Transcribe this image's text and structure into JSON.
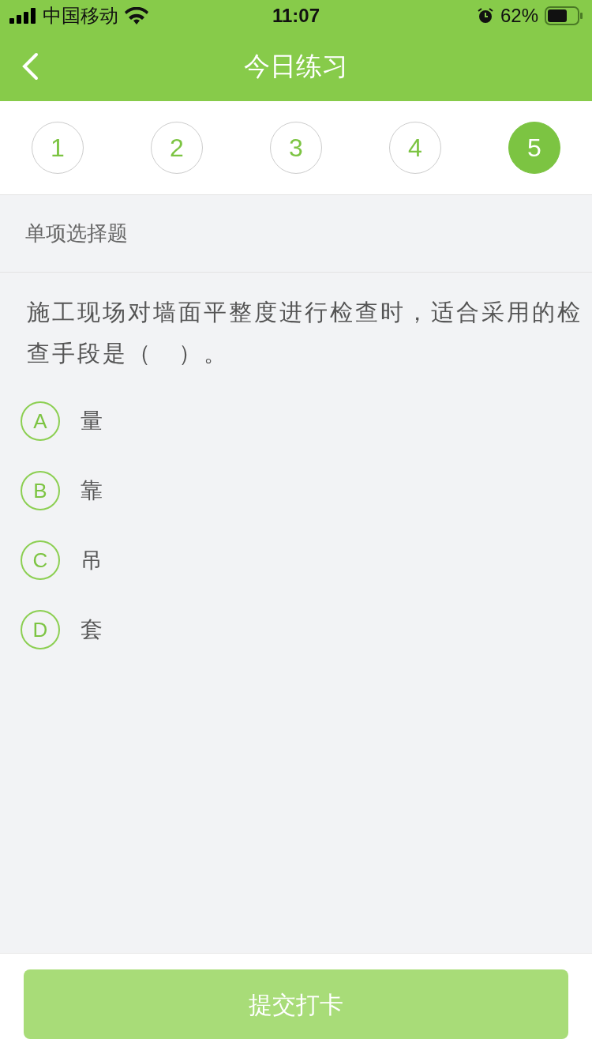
{
  "status_bar": {
    "carrier": "中国移动",
    "time": "11:07",
    "battery": "62%"
  },
  "nav": {
    "title": "今日练习"
  },
  "steps": [
    {
      "label": "1",
      "selected": false
    },
    {
      "label": "2",
      "selected": false
    },
    {
      "label": "3",
      "selected": false
    },
    {
      "label": "4",
      "selected": false
    },
    {
      "label": "5",
      "selected": true
    }
  ],
  "question": {
    "type": "单项选择题",
    "text": "施工现场对墙面平整度进行检查时，适合采用的检查手段是（　）。",
    "options": [
      {
        "letter": "A",
        "text": "量",
        "selected": false
      },
      {
        "letter": "B",
        "text": "靠",
        "selected": false
      },
      {
        "letter": "C",
        "text": "吊",
        "selected": false
      },
      {
        "letter": "D",
        "text": "套",
        "selected": false
      }
    ]
  },
  "submit": {
    "label": "提交打卡",
    "disabled": true
  }
}
